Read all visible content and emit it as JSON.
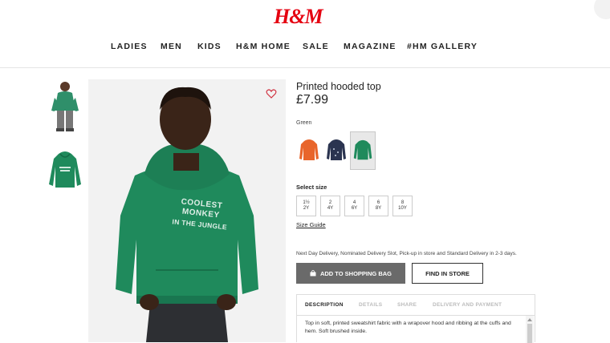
{
  "header": {
    "logo": "H&M",
    "nav": [
      "LADIES",
      "MEN",
      "KIDS",
      "H&M HOME",
      "SALE",
      "MAGAZINE",
      "#HM GALLERY"
    ]
  },
  "product": {
    "title": "Printed hooded top",
    "price": "£7.99",
    "color_label": "Green",
    "swatches": [
      {
        "color": "#e8652b",
        "name": "orange"
      },
      {
        "color": "#2b3450",
        "name": "navy"
      },
      {
        "color": "#1f8a5c",
        "name": "green",
        "selected": true
      }
    ],
    "hoodie_print": [
      "COOLEST MONKEY",
      "IN THE JUNGLE"
    ],
    "hoodie_color": "#1f8a5c",
    "size_label": "Select size",
    "sizes": [
      {
        "top": "1½",
        "bottom": "2Y"
      },
      {
        "top": "2",
        "bottom": "4Y"
      },
      {
        "top": "4",
        "bottom": "6Y"
      },
      {
        "top": "6",
        "bottom": "8Y"
      },
      {
        "top": "8",
        "bottom": "10Y"
      }
    ],
    "size_guide": "Size Guide",
    "delivery_text": "Next Day Delivery, Nominated Delivery Slot, Pick-up in store and Standard Delivery in 2-3 days.",
    "add_to_bag": "ADD TO SHOPPING BAG",
    "find_in_store": "FIND IN STORE",
    "tabs": [
      "DESCRIPTION",
      "DETAILS",
      "SHARE",
      "DELIVERY AND PAYMENT"
    ],
    "description": "Top in soft, printed sweatshirt fabric with a wrapover hood and ribbing at the cuffs and hem. Soft brushed inside."
  },
  "colors": {
    "brand": "#e50010",
    "button_dark": "#6a6a6a"
  }
}
